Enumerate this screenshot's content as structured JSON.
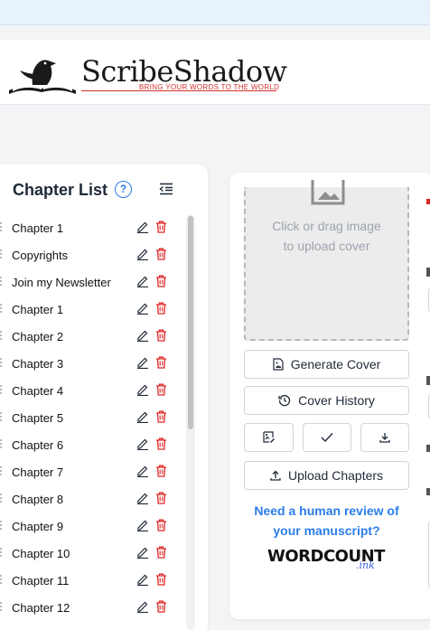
{
  "brand": {
    "name": "ScribeShadow",
    "tagline": "BRING YOUR WORDS TO THE WORLD"
  },
  "chapter_panel": {
    "title": "Chapter List",
    "help_symbol": "?",
    "chapters": [
      {
        "label": "Chapter 1"
      },
      {
        "label": "Copyrights"
      },
      {
        "label": "Join my Newsletter"
      },
      {
        "label": "Chapter 1"
      },
      {
        "label": "Chapter 2"
      },
      {
        "label": "Chapter 3"
      },
      {
        "label": "Chapter 4"
      },
      {
        "label": "Chapter 5"
      },
      {
        "label": "Chapter 6"
      },
      {
        "label": "Chapter 7"
      },
      {
        "label": "Chapter 8"
      },
      {
        "label": "Chapter 9"
      },
      {
        "label": "Chapter 10"
      },
      {
        "label": "Chapter 11"
      },
      {
        "label": "Chapter 12"
      }
    ]
  },
  "cover_panel": {
    "dropzone_line1": "Click or drag image",
    "dropzone_line2": "to upload cover",
    "generate_label": "Generate Cover",
    "history_label": "Cover History",
    "upload_label": "Upload Chapters",
    "promo_line1": "Need a human review of",
    "promo_line2": "your manuscript?",
    "partner_logo": "WORDCOUNT",
    "partner_logo_suffix": ".ink"
  },
  "colors": {
    "accent_blue": "#2b7de9",
    "delete_red": "#e02424",
    "brand_red": "#d0312d"
  }
}
